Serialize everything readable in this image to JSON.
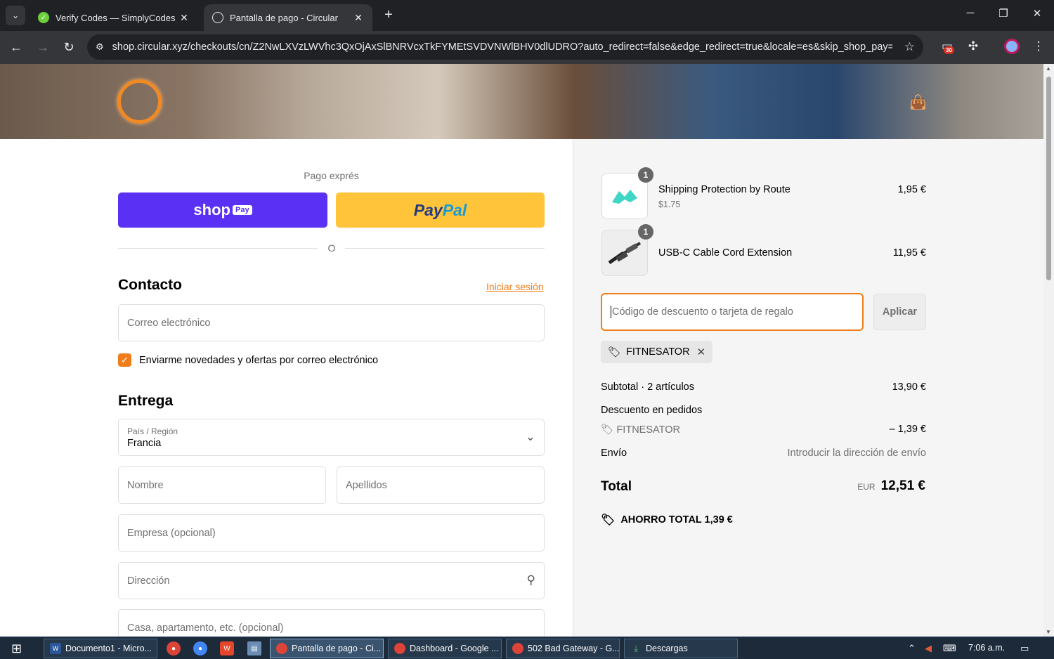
{
  "browser": {
    "tabs": [
      {
        "title": "Verify Codes — SimplyCodes",
        "active": false
      },
      {
        "title": "Pantalla de pago - Circular",
        "active": true
      }
    ],
    "url": "shop.circular.xyz/checkouts/cn/Z2NwLXVzLWVhc3QxOjAxSlBNRVcxTkFYMEtSVDVNWlBHV0dlUDRO?auto_redirect=false&edge_redirect=true&locale=es&skip_shop_pay=t...",
    "extension_badge": "30"
  },
  "checkout": {
    "express_label": "Pago exprés",
    "shoppay": {
      "brand": "shop",
      "pay": "Pay"
    },
    "paypal": {
      "part1": "Pay",
      "part2": "Pal"
    },
    "divider": "O",
    "contact": {
      "title": "Contacto",
      "login_link": "Iniciar sesión",
      "email_placeholder": "Correo electrónico",
      "newsletter_label": "Enviarme novedades y ofertas por correo electrónico",
      "newsletter_checked": true
    },
    "delivery": {
      "title": "Entrega",
      "country_label": "País / Región",
      "country_value": "Francia",
      "first_name": "Nombre",
      "last_name": "Apellidos",
      "company": "Empresa (opcional)",
      "address": "Dirección",
      "apartment": "Casa, apartamento, etc. (opcional)"
    }
  },
  "summary": {
    "items": [
      {
        "name": "Shipping Protection by Route",
        "sub": "$1.75",
        "price": "1,95 €",
        "qty": "1"
      },
      {
        "name": "USB-C Cable Cord Extension",
        "sub": "",
        "price": "11,95 €",
        "qty": "1"
      }
    ],
    "discount_placeholder": "Código de descuento o tarjeta de regalo",
    "apply_label": "Aplicar",
    "applied_code": "FITNESATOR",
    "subtotal_label": "Subtotal · 2 artículos",
    "subtotal_value": "13,90 €",
    "order_discount_label": "Descuento en pedidos",
    "order_discount_code": "FITNESATOR",
    "order_discount_value": "– 1,39 €",
    "shipping_label": "Envío",
    "shipping_value": "Introducir la dirección de envío",
    "total_label": "Total",
    "total_currency": "EUR",
    "total_value": "12,51 €",
    "savings": "AHORRO TOTAL  1,39 €"
  },
  "taskbar": {
    "tasks": [
      {
        "label": "Documento1 - Micro...",
        "active": false
      },
      {
        "label": "Pantalla de pago - Ci...",
        "active": true
      },
      {
        "label": "Dashboard - Google ...",
        "active": false
      },
      {
        "label": "502 Bad Gateway - G...",
        "active": false
      },
      {
        "label": "Descargas",
        "active": false
      }
    ],
    "time": "7:06 a.m."
  },
  "colors": {
    "accent": "#f07d1a",
    "shoppay": "#5a31f4",
    "paypal": "#ffc439"
  }
}
